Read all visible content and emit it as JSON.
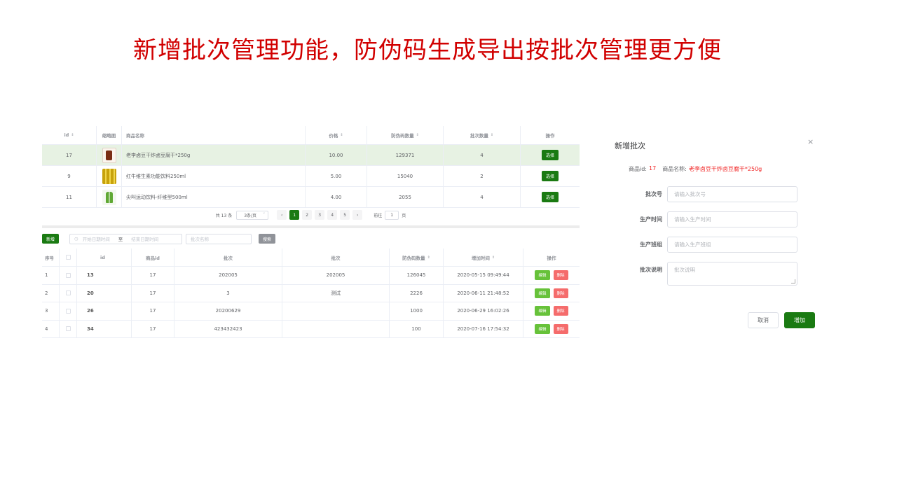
{
  "slide_title": "新增批次管理功能，防伪码生成导出按批次管理更方便",
  "product_table": {
    "headers": {
      "id": "id",
      "thumb": "缩略图",
      "name": "商品名称",
      "price": "价格",
      "code_count": "防伪码数量",
      "batch_count": "批次数量",
      "op": "操作"
    },
    "rows": [
      {
        "id": "17",
        "name": "老李卤豆干炸卤豆腐干*250g",
        "price": "10.00",
        "code_count": "129371",
        "batch_count": "4",
        "action": "选择"
      },
      {
        "id": "9",
        "name": "红牛维生素功能饮料250ml",
        "price": "5.00",
        "code_count": "15040",
        "batch_count": "2",
        "action": "选择"
      },
      {
        "id": "11",
        "name": "尖叫运动饮料-纤维型500ml",
        "price": "4.00",
        "code_count": "2055",
        "batch_count": "4",
        "action": "选择"
      }
    ]
  },
  "pager": {
    "total": "共 13 条",
    "page_size": "3条/页",
    "prev": "‹",
    "pages": [
      "1",
      "2",
      "3",
      "4",
      "5"
    ],
    "next": "›",
    "goto_label": "前往",
    "goto_value": "1",
    "goto_suffix": "页"
  },
  "toolbar": {
    "add_label": "新增",
    "clock_icon": "◷",
    "start_placeholder": "开始日期时间",
    "range_sep": "至",
    "end_placeholder": "结束日期时间",
    "batch_placeholder": "批次名称",
    "search_label": "搜索"
  },
  "batch_table": {
    "headers": {
      "no": "序号",
      "id": "id",
      "pid": "商品id",
      "batch1": "批次",
      "batch2": "批次",
      "code_count": "防伪码数量",
      "time": "增加时间",
      "op": "操作"
    },
    "rows": [
      {
        "no": "1",
        "id": "13",
        "pid": "17",
        "batch1": "202005",
        "batch2": "202005",
        "code_count": "126045",
        "time": "2020-05-15 09:49:44"
      },
      {
        "no": "2",
        "id": "20",
        "pid": "17",
        "batch1": "3",
        "batch2": "测试",
        "code_count": "2226",
        "time": "2020-06-11 21:48:52"
      },
      {
        "no": "3",
        "id": "26",
        "pid": "17",
        "batch1": "20200629",
        "batch2": "",
        "code_count": "1000",
        "time": "2020-06-29 16:02:26"
      },
      {
        "no": "4",
        "id": "34",
        "pid": "17",
        "batch1": "423432423",
        "batch2": "",
        "code_count": "100",
        "time": "2020-07-16 17:54:32"
      }
    ],
    "edit_label": "编辑",
    "delete_label": "删除"
  },
  "dialog": {
    "title": "新增批次",
    "close": "×",
    "info_pid_label": "商品id:",
    "info_pid": "17",
    "info_name_label": "商品名称:",
    "info_name": "老李卤豆干炸卤豆腐干*250g",
    "fields": [
      {
        "label": "批次号",
        "placeholder": "请输入批次号"
      },
      {
        "label": "生产时间",
        "placeholder": "请输入生产时间"
      },
      {
        "label": "生产班组",
        "placeholder": "请输入生产班组"
      },
      {
        "label": "批次说明",
        "placeholder": "批次说明"
      }
    ],
    "cancel_label": "取消",
    "confirm_label": "增加"
  },
  "colors": {
    "primary": "#1a7a12",
    "title_red": "#d10000",
    "edit": "#67c23a",
    "delete": "#f56c6c",
    "highlight_row": "#e7f2e3"
  }
}
